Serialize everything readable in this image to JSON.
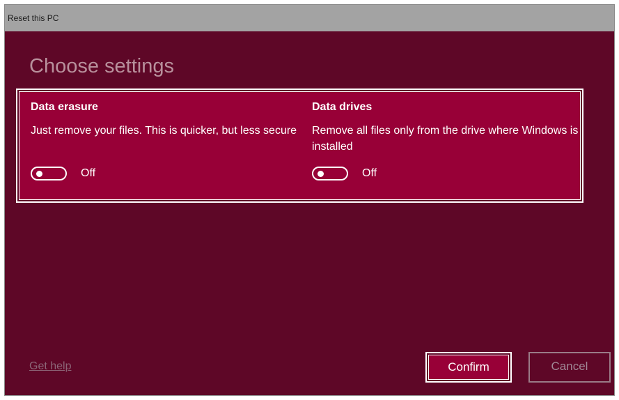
{
  "window": {
    "title": "Reset this PC"
  },
  "heading": "Choose settings",
  "settings": [
    {
      "title": "Data erasure",
      "description": "Just remove your files. This is quicker, but less secure",
      "toggle_state": "Off",
      "toggle_on": false
    },
    {
      "title": "Data drives",
      "description": "Remove all files only from the drive where Windows is installed",
      "toggle_state": "Off",
      "toggle_on": false
    }
  ],
  "footer": {
    "help_link": "Get help",
    "confirm_label": "Confirm",
    "cancel_label": "Cancel"
  },
  "colors": {
    "window_background": "#5e0727",
    "panel_background": "#980037",
    "titlebar_background": "#a3a3a3",
    "text": "#ffffff"
  }
}
